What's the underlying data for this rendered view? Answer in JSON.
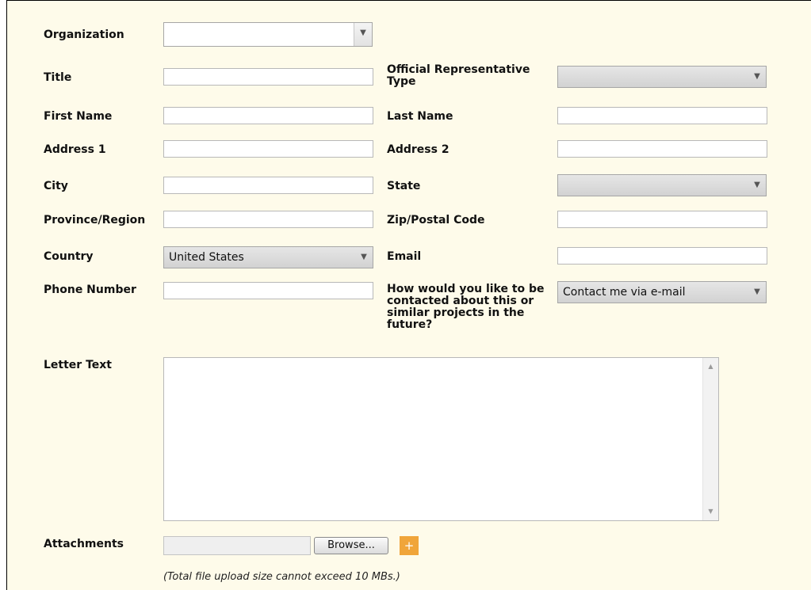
{
  "form": {
    "organization": {
      "label": "Organization",
      "value": ""
    },
    "title": {
      "label": "Title",
      "value": ""
    },
    "official_rep_type": {
      "label": "Official Representative Type",
      "value": ""
    },
    "first_name": {
      "label": "First Name",
      "value": ""
    },
    "last_name": {
      "label": "Last Name",
      "value": ""
    },
    "address1": {
      "label": "Address 1",
      "value": ""
    },
    "address2": {
      "label": "Address 2",
      "value": ""
    },
    "city": {
      "label": "City",
      "value": ""
    },
    "state": {
      "label": "State",
      "value": ""
    },
    "province": {
      "label": "Province/Region",
      "value": ""
    },
    "zip": {
      "label": "Zip/Postal Code",
      "value": ""
    },
    "country": {
      "label": "Country",
      "value": "United States"
    },
    "email": {
      "label": "Email",
      "value": ""
    },
    "phone": {
      "label": "Phone Number",
      "value": ""
    },
    "contact_pref": {
      "label": "How would you like to be contacted about this or similar projects in the future?",
      "value": "Contact me via e-mail"
    },
    "letter_text": {
      "label": "Letter Text",
      "value": ""
    },
    "attachments": {
      "label": "Attachments",
      "browse_label": "Browse...",
      "add_label": "+",
      "note": "(Total file upload size cannot exceed 10 MBs.)"
    }
  },
  "icons": {
    "dropdown_arrow": "chevron-down-icon",
    "scroll_up": "scroll-up-icon",
    "scroll_down": "scroll-down-icon",
    "add": "plus-icon"
  },
  "colors": {
    "panel_background": "#fefbea",
    "add_button": "#f0a53a"
  }
}
